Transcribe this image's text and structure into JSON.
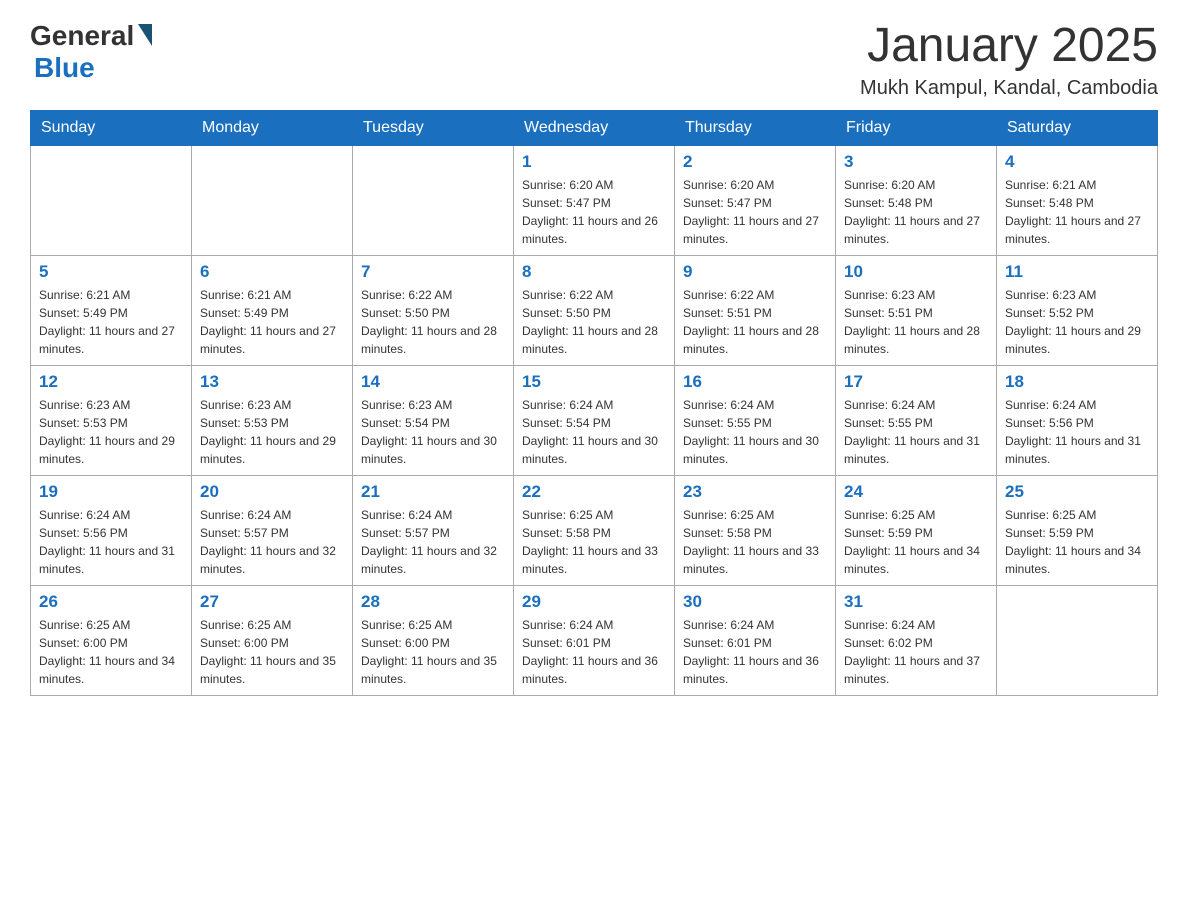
{
  "header": {
    "logo": {
      "general": "General",
      "blue": "Blue"
    },
    "title": "January 2025",
    "location": "Mukh Kampul, Kandal, Cambodia"
  },
  "calendar": {
    "days_of_week": [
      "Sunday",
      "Monday",
      "Tuesday",
      "Wednesday",
      "Thursday",
      "Friday",
      "Saturday"
    ],
    "weeks": [
      [
        {
          "day": "",
          "info": ""
        },
        {
          "day": "",
          "info": ""
        },
        {
          "day": "",
          "info": ""
        },
        {
          "day": "1",
          "info": "Sunrise: 6:20 AM\nSunset: 5:47 PM\nDaylight: 11 hours and 26 minutes."
        },
        {
          "day": "2",
          "info": "Sunrise: 6:20 AM\nSunset: 5:47 PM\nDaylight: 11 hours and 27 minutes."
        },
        {
          "day": "3",
          "info": "Sunrise: 6:20 AM\nSunset: 5:48 PM\nDaylight: 11 hours and 27 minutes."
        },
        {
          "day": "4",
          "info": "Sunrise: 6:21 AM\nSunset: 5:48 PM\nDaylight: 11 hours and 27 minutes."
        }
      ],
      [
        {
          "day": "5",
          "info": "Sunrise: 6:21 AM\nSunset: 5:49 PM\nDaylight: 11 hours and 27 minutes."
        },
        {
          "day": "6",
          "info": "Sunrise: 6:21 AM\nSunset: 5:49 PM\nDaylight: 11 hours and 27 minutes."
        },
        {
          "day": "7",
          "info": "Sunrise: 6:22 AM\nSunset: 5:50 PM\nDaylight: 11 hours and 28 minutes."
        },
        {
          "day": "8",
          "info": "Sunrise: 6:22 AM\nSunset: 5:50 PM\nDaylight: 11 hours and 28 minutes."
        },
        {
          "day": "9",
          "info": "Sunrise: 6:22 AM\nSunset: 5:51 PM\nDaylight: 11 hours and 28 minutes."
        },
        {
          "day": "10",
          "info": "Sunrise: 6:23 AM\nSunset: 5:51 PM\nDaylight: 11 hours and 28 minutes."
        },
        {
          "day": "11",
          "info": "Sunrise: 6:23 AM\nSunset: 5:52 PM\nDaylight: 11 hours and 29 minutes."
        }
      ],
      [
        {
          "day": "12",
          "info": "Sunrise: 6:23 AM\nSunset: 5:53 PM\nDaylight: 11 hours and 29 minutes."
        },
        {
          "day": "13",
          "info": "Sunrise: 6:23 AM\nSunset: 5:53 PM\nDaylight: 11 hours and 29 minutes."
        },
        {
          "day": "14",
          "info": "Sunrise: 6:23 AM\nSunset: 5:54 PM\nDaylight: 11 hours and 30 minutes."
        },
        {
          "day": "15",
          "info": "Sunrise: 6:24 AM\nSunset: 5:54 PM\nDaylight: 11 hours and 30 minutes."
        },
        {
          "day": "16",
          "info": "Sunrise: 6:24 AM\nSunset: 5:55 PM\nDaylight: 11 hours and 30 minutes."
        },
        {
          "day": "17",
          "info": "Sunrise: 6:24 AM\nSunset: 5:55 PM\nDaylight: 11 hours and 31 minutes."
        },
        {
          "day": "18",
          "info": "Sunrise: 6:24 AM\nSunset: 5:56 PM\nDaylight: 11 hours and 31 minutes."
        }
      ],
      [
        {
          "day": "19",
          "info": "Sunrise: 6:24 AM\nSunset: 5:56 PM\nDaylight: 11 hours and 31 minutes."
        },
        {
          "day": "20",
          "info": "Sunrise: 6:24 AM\nSunset: 5:57 PM\nDaylight: 11 hours and 32 minutes."
        },
        {
          "day": "21",
          "info": "Sunrise: 6:24 AM\nSunset: 5:57 PM\nDaylight: 11 hours and 32 minutes."
        },
        {
          "day": "22",
          "info": "Sunrise: 6:25 AM\nSunset: 5:58 PM\nDaylight: 11 hours and 33 minutes."
        },
        {
          "day": "23",
          "info": "Sunrise: 6:25 AM\nSunset: 5:58 PM\nDaylight: 11 hours and 33 minutes."
        },
        {
          "day": "24",
          "info": "Sunrise: 6:25 AM\nSunset: 5:59 PM\nDaylight: 11 hours and 34 minutes."
        },
        {
          "day": "25",
          "info": "Sunrise: 6:25 AM\nSunset: 5:59 PM\nDaylight: 11 hours and 34 minutes."
        }
      ],
      [
        {
          "day": "26",
          "info": "Sunrise: 6:25 AM\nSunset: 6:00 PM\nDaylight: 11 hours and 34 minutes."
        },
        {
          "day": "27",
          "info": "Sunrise: 6:25 AM\nSunset: 6:00 PM\nDaylight: 11 hours and 35 minutes."
        },
        {
          "day": "28",
          "info": "Sunrise: 6:25 AM\nSunset: 6:00 PM\nDaylight: 11 hours and 35 minutes."
        },
        {
          "day": "29",
          "info": "Sunrise: 6:24 AM\nSunset: 6:01 PM\nDaylight: 11 hours and 36 minutes."
        },
        {
          "day": "30",
          "info": "Sunrise: 6:24 AM\nSunset: 6:01 PM\nDaylight: 11 hours and 36 minutes."
        },
        {
          "day": "31",
          "info": "Sunrise: 6:24 AM\nSunset: 6:02 PM\nDaylight: 11 hours and 37 minutes."
        },
        {
          "day": "",
          "info": ""
        }
      ]
    ]
  }
}
